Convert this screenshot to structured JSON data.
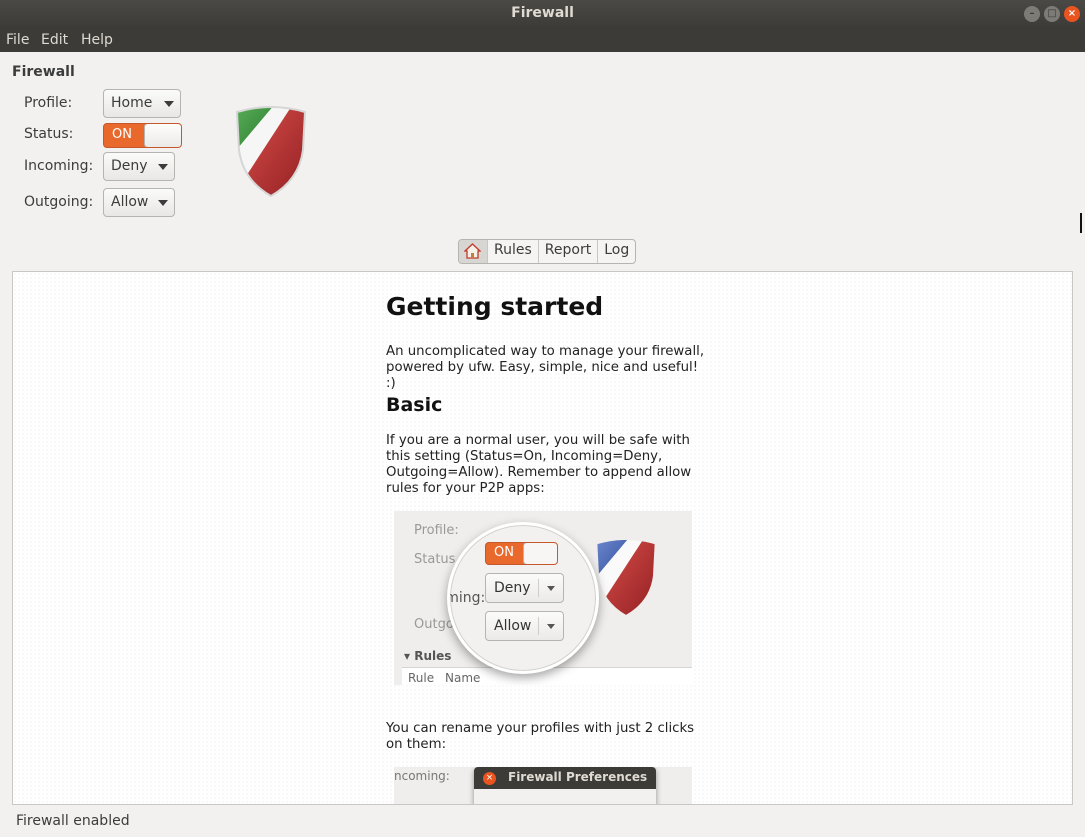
{
  "window": {
    "title": "Firewall",
    "close_glyph": "×",
    "minimize_glyph": "–",
    "maximize_glyph": "□"
  },
  "menu": {
    "items": [
      "File",
      "Edit",
      "Help"
    ]
  },
  "firewall": {
    "section_title": "Firewall",
    "profile_label": "Profile:",
    "profile_value": "Home",
    "status_label": "Status:",
    "status_value": "ON",
    "incoming_label": "Incoming:",
    "incoming_value": "Deny",
    "outgoing_label": "Outgoing:",
    "outgoing_value": "Allow"
  },
  "tabs": {
    "home_icon": "home-icon",
    "items": [
      "Rules",
      "Report",
      "Log"
    ]
  },
  "article": {
    "title": "Getting started",
    "intro": "An uncomplicated way to manage your firewall, powered by ufw. Easy, simple, nice and useful! :)",
    "basic_heading": "Basic",
    "basic_text": "If you are a normal user, you will be safe with this setting (Status=On, Incoming=Deny, Outgoing=Allow). Remember to append allow rules for your P2P apps:",
    "rename_text": "You can rename your profiles with just 2 clicks on them:"
  },
  "screenshot1": {
    "profile_label": "Profile:",
    "status_label": "Status",
    "incoming_label": "Incoming:",
    "outgoing_label": "Outgoing:",
    "switch_value": "ON",
    "incoming_value": "Deny",
    "outgoing_value": "Allow",
    "rules_label": "▾ Rules",
    "col_rule": "Rule",
    "col_name": "Name"
  },
  "screenshot2": {
    "incoming_label": "ncoming:",
    "dialog_title": "Firewall Preferences"
  },
  "statusbar": {
    "text": "Firewall enabled"
  },
  "colors": {
    "accent": "#e9692c",
    "titlebar": "#3c3b37",
    "close": "#e95420"
  }
}
